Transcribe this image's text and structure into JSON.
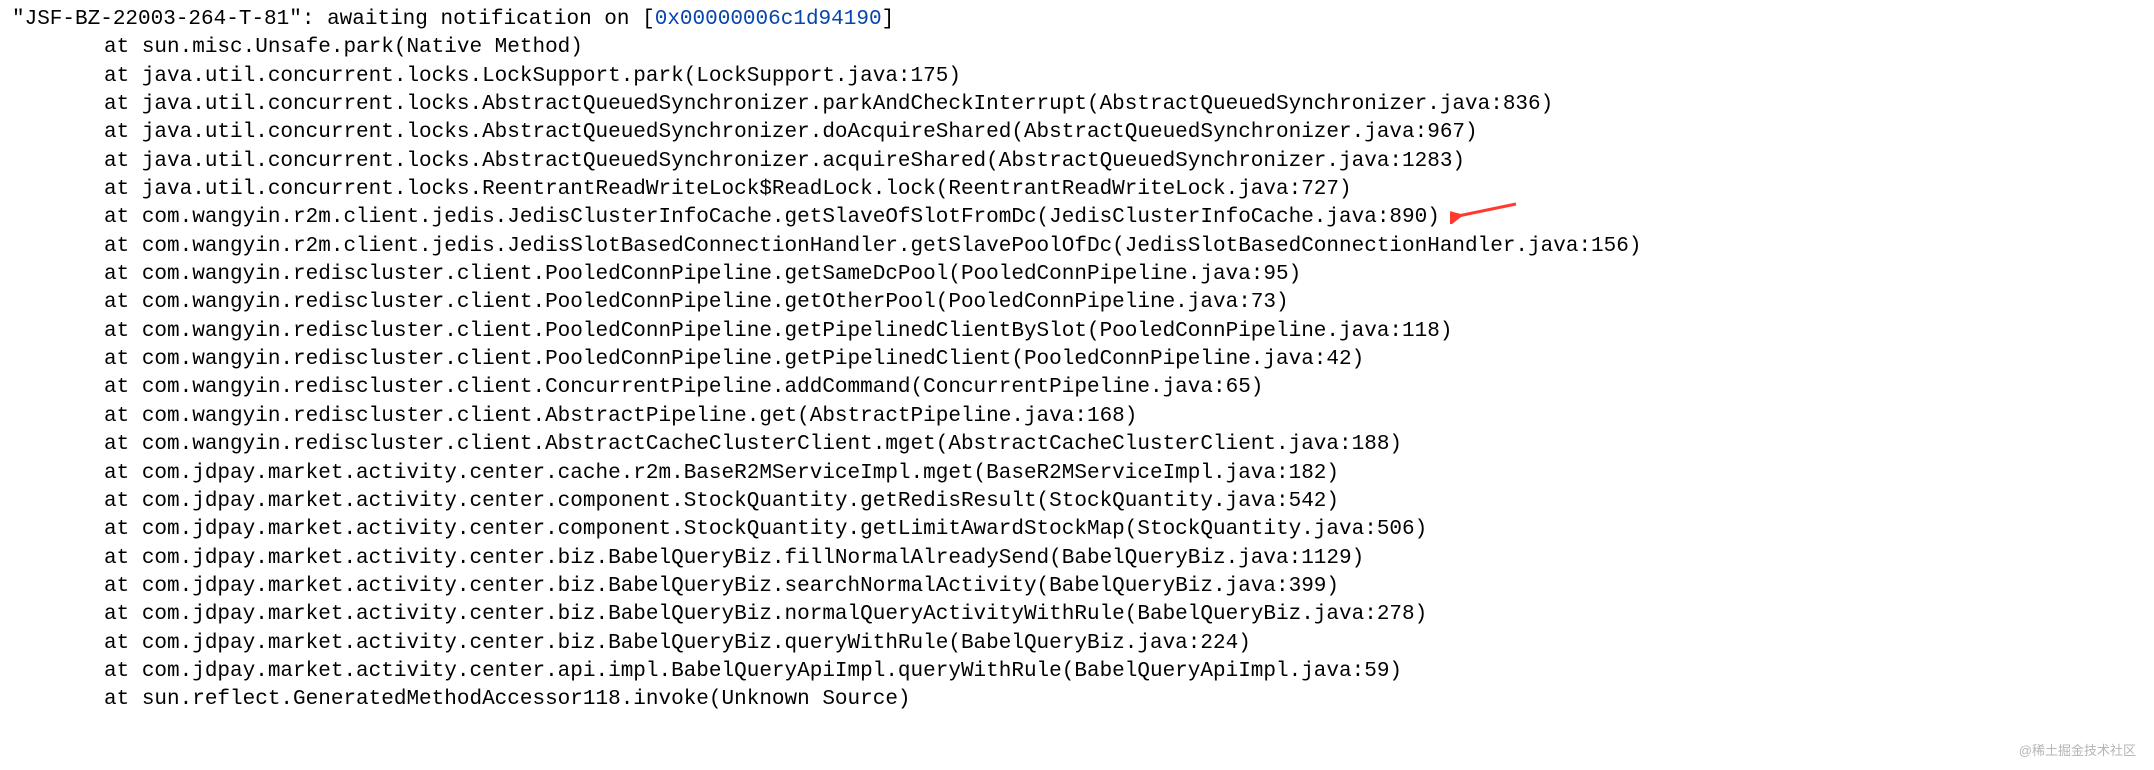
{
  "header": {
    "thread_name": "\"JSF-BZ-22003-264-T-81\"",
    "status_prefix": ": awaiting notification on [",
    "address": "0x00000006c1d94190",
    "status_suffix": "]"
  },
  "at_prefix": "at ",
  "stack": [
    "sun.misc.Unsafe.park(Native Method)",
    "java.util.concurrent.locks.LockSupport.park(LockSupport.java:175)",
    "java.util.concurrent.locks.AbstractQueuedSynchronizer.parkAndCheckInterrupt(AbstractQueuedSynchronizer.java:836)",
    "java.util.concurrent.locks.AbstractQueuedSynchronizer.doAcquireShared(AbstractQueuedSynchronizer.java:967)",
    "java.util.concurrent.locks.AbstractQueuedSynchronizer.acquireShared(AbstractQueuedSynchronizer.java:1283)",
    "java.util.concurrent.locks.ReentrantReadWriteLock$ReadLock.lock(ReentrantReadWriteLock.java:727)",
    "com.wangyin.r2m.client.jedis.JedisClusterInfoCache.getSlaveOfSlotFromDc(JedisClusterInfoCache.java:890)",
    "com.wangyin.r2m.client.jedis.JedisSlotBasedConnectionHandler.getSlavePoolOfDc(JedisSlotBasedConnectionHandler.java:156)",
    "com.wangyin.rediscluster.client.PooledConnPipeline.getSameDcPool(PooledConnPipeline.java:95)",
    "com.wangyin.rediscluster.client.PooledConnPipeline.getOtherPool(PooledConnPipeline.java:73)",
    "com.wangyin.rediscluster.client.PooledConnPipeline.getPipelinedClientBySlot(PooledConnPipeline.java:118)",
    "com.wangyin.rediscluster.client.PooledConnPipeline.getPipelinedClient(PooledConnPipeline.java:42)",
    "com.wangyin.rediscluster.client.ConcurrentPipeline.addCommand(ConcurrentPipeline.java:65)",
    "com.wangyin.rediscluster.client.AbstractPipeline.get(AbstractPipeline.java:168)",
    "com.wangyin.rediscluster.client.AbstractCacheClusterClient.mget(AbstractCacheClusterClient.java:188)",
    "com.jdpay.market.activity.center.cache.r2m.BaseR2MServiceImpl.mget(BaseR2MServiceImpl.java:182)",
    "com.jdpay.market.activity.center.component.StockQuantity.getRedisResult(StockQuantity.java:542)",
    "com.jdpay.market.activity.center.component.StockQuantity.getLimitAwardStockMap(StockQuantity.java:506)",
    "com.jdpay.market.activity.center.biz.BabelQueryBiz.fillNormalAlreadySend(BabelQueryBiz.java:1129)",
    "com.jdpay.market.activity.center.biz.BabelQueryBiz.searchNormalActivity(BabelQueryBiz.java:399)",
    "com.jdpay.market.activity.center.biz.BabelQueryBiz.normalQueryActivityWithRule(BabelQueryBiz.java:278)",
    "com.jdpay.market.activity.center.biz.BabelQueryBiz.queryWithRule(BabelQueryBiz.java:224)",
    "com.jdpay.market.activity.center.api.impl.BabelQueryApiImpl.queryWithRule(BabelQueryApiImpl.java:59)",
    "sun.reflect.GeneratedMethodAccessor118.invoke(Unknown Source)"
  ],
  "highlight_index": 6,
  "watermark": "@稀土掘金技术社区"
}
